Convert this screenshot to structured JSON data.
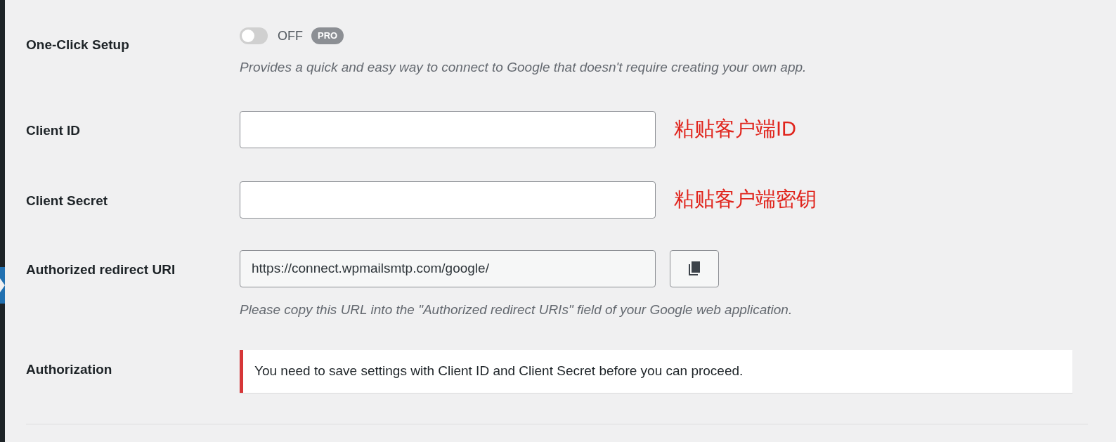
{
  "rows": [
    {
      "kind": "toggle",
      "label": "One-Click Setup",
      "toggle": {
        "on": false,
        "state_label": "OFF",
        "badge": "PRO"
      },
      "description": "Provides a quick and easy way to connect to Google that doesn't require creating your own app."
    },
    {
      "kind": "input",
      "label": "Client ID",
      "value": "",
      "annotation": "粘贴客户端ID"
    },
    {
      "kind": "input",
      "label": "Client Secret",
      "value": "",
      "annotation": "粘贴客户端密钥"
    },
    {
      "kind": "copy",
      "label": "Authorized redirect URI",
      "value": "https://connect.wpmailsmtp.com/google/",
      "description": "Please copy this URL into the \"Authorized redirect URIs\" field of your Google web application."
    },
    {
      "kind": "notice",
      "label": "Authorization",
      "notice": "You need to save settings with Client ID and Client Secret before you can proceed."
    }
  ]
}
